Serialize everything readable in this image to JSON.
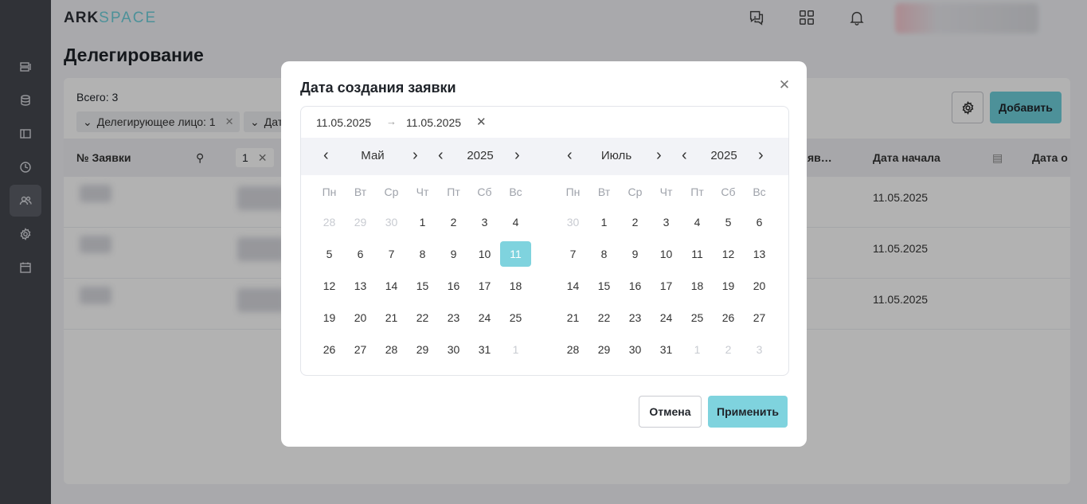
{
  "app": {
    "logo_part1": "ARK",
    "logo_part2": "SPACE"
  },
  "page": {
    "title": "Делегирование",
    "total": "Всего: 3",
    "filters": [
      "Делегирующее лицо: 1",
      "Дат"
    ],
    "add_label": "Добавить"
  },
  "table": {
    "headers": {
      "number": "№ Заявки",
      "filter_value": "1",
      "short_col": "яв…",
      "start_date": "Дата начала",
      "end_date": "Дата о"
    },
    "rows": [
      {
        "start_date": "11.05.2025"
      },
      {
        "start_date": "11.05.2025"
      },
      {
        "start_date": "11.05.2025"
      }
    ]
  },
  "modal": {
    "title": "Дата создания заявки",
    "range_from": "11.05.2025",
    "range_to": "11.05.2025",
    "left": {
      "month": "Май",
      "year": "2025"
    },
    "right": {
      "month": "Июль",
      "year": "2025"
    },
    "weekdays": [
      "Пн",
      "Вт",
      "Ср",
      "Чт",
      "Пт",
      "Сб",
      "Вс"
    ],
    "cancel_label": "Отмена",
    "apply_label": "Применить"
  },
  "calendars": {
    "left": [
      [
        [
          "28",
          "m"
        ],
        [
          "29",
          "m"
        ],
        [
          "30",
          "m"
        ],
        [
          "1",
          ""
        ],
        [
          "2",
          ""
        ],
        [
          "3",
          ""
        ],
        [
          "4",
          ""
        ]
      ],
      [
        [
          "5",
          ""
        ],
        [
          "6",
          ""
        ],
        [
          "7",
          ""
        ],
        [
          "8",
          ""
        ],
        [
          "9",
          ""
        ],
        [
          "10",
          ""
        ],
        [
          "11",
          "s"
        ]
      ],
      [
        [
          "12",
          ""
        ],
        [
          "13",
          ""
        ],
        [
          "14",
          ""
        ],
        [
          "15",
          ""
        ],
        [
          "16",
          ""
        ],
        [
          "17",
          ""
        ],
        [
          "18",
          ""
        ]
      ],
      [
        [
          "19",
          ""
        ],
        [
          "20",
          ""
        ],
        [
          "21",
          ""
        ],
        [
          "22",
          ""
        ],
        [
          "23",
          ""
        ],
        [
          "24",
          ""
        ],
        [
          "25",
          ""
        ]
      ],
      [
        [
          "26",
          ""
        ],
        [
          "27",
          ""
        ],
        [
          "28",
          ""
        ],
        [
          "29",
          ""
        ],
        [
          "30",
          ""
        ],
        [
          "31",
          ""
        ],
        [
          "1",
          "m"
        ]
      ]
    ],
    "right": [
      [
        [
          "30",
          "m"
        ],
        [
          "1",
          ""
        ],
        [
          "2",
          ""
        ],
        [
          "3",
          ""
        ],
        [
          "4",
          ""
        ],
        [
          "5",
          ""
        ],
        [
          "6",
          ""
        ]
      ],
      [
        [
          "7",
          ""
        ],
        [
          "8",
          ""
        ],
        [
          "9",
          ""
        ],
        [
          "10",
          ""
        ],
        [
          "11",
          ""
        ],
        [
          "12",
          ""
        ],
        [
          "13",
          ""
        ]
      ],
      [
        [
          "14",
          ""
        ],
        [
          "15",
          ""
        ],
        [
          "16",
          ""
        ],
        [
          "17",
          ""
        ],
        [
          "18",
          ""
        ],
        [
          "19",
          ""
        ],
        [
          "20",
          ""
        ]
      ],
      [
        [
          "21",
          ""
        ],
        [
          "22",
          ""
        ],
        [
          "23",
          ""
        ],
        [
          "24",
          ""
        ],
        [
          "25",
          ""
        ],
        [
          "26",
          ""
        ],
        [
          "27",
          ""
        ]
      ],
      [
        [
          "28",
          ""
        ],
        [
          "29",
          ""
        ],
        [
          "30",
          ""
        ],
        [
          "31",
          ""
        ],
        [
          "1",
          "m"
        ],
        [
          "2",
          "m"
        ],
        [
          "3",
          "m"
        ]
      ]
    ]
  },
  "colors": {
    "accent": "#7fd3de",
    "sidebar": "#454850",
    "selected_text": "#ffffff"
  },
  "icons": [
    "list-icon",
    "database-icon",
    "panel-icon",
    "history-icon",
    "users-icon",
    "gear-icon",
    "calendar-icon",
    "help-chat-icon",
    "apps-grid-icon",
    "bell-icon"
  ]
}
